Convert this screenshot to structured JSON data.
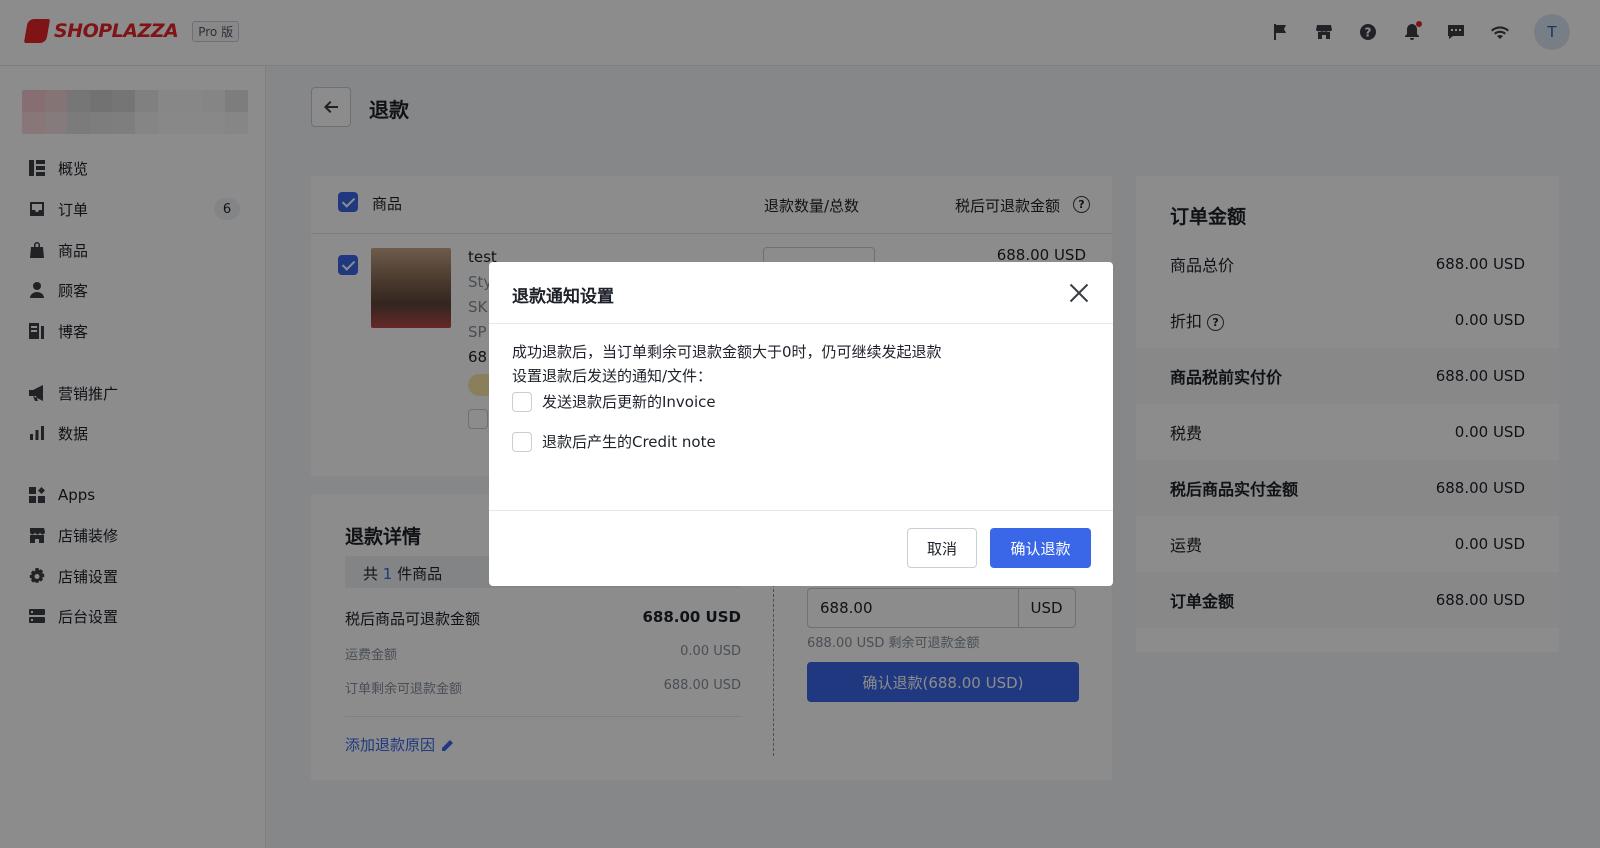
{
  "header": {
    "brand": "SHOPLAZZA",
    "plan_badge": "Pro 版",
    "icons": [
      "flag-icon",
      "store-icon",
      "help-icon",
      "bell-icon",
      "chat-icon",
      "wifi-icon"
    ],
    "avatar_initial": "T"
  },
  "sidebar": {
    "items": [
      {
        "label": "概览",
        "icon": "overview-icon"
      },
      {
        "label": "订单",
        "icon": "orders-icon",
        "badge": "6"
      },
      {
        "label": "商品",
        "icon": "products-icon"
      },
      {
        "label": "顾客",
        "icon": "customers-icon"
      },
      {
        "label": "博客",
        "icon": "blog-icon"
      },
      {
        "label": "营销推广",
        "icon": "megaphone-icon"
      },
      {
        "label": "数据",
        "icon": "analytics-icon"
      },
      {
        "label": "Apps",
        "icon": "apps-icon"
      },
      {
        "label": "店铺装修",
        "icon": "storefront-icon"
      },
      {
        "label": "店铺设置",
        "icon": "settings-icon"
      },
      {
        "label": "后台设置",
        "icon": "server-icon"
      }
    ]
  },
  "page": {
    "title": "退款"
  },
  "products": {
    "header_product": "商品",
    "header_qty": "退款数量/总数",
    "header_amount": "税后可退款金额",
    "item": {
      "name": "test",
      "line2": "Sty",
      "line3": "SK",
      "line4": "SP",
      "line5": "68",
      "amount": "688.00 USD"
    }
  },
  "details": {
    "title": "退款详情",
    "count_prefix": "共",
    "count": "1",
    "count_suffix": "件商品",
    "rows": [
      {
        "label": "税后商品可退款金额",
        "value": "688.00 USD"
      },
      {
        "label": "运费金额",
        "value": "0.00 USD"
      },
      {
        "label": "订单剩余可退款金额",
        "value": "688.00 USD"
      }
    ],
    "add_reason": "添加退款原因",
    "refund_amount": "688.00",
    "currency": "USD",
    "remaining_note": "688.00 USD 剩余可退款金额",
    "confirm_button": "确认退款(688.00 USD)"
  },
  "summary": {
    "title": "订单金额",
    "rows": [
      {
        "label": "商品总价",
        "value": "688.00 USD"
      },
      {
        "label": "折扣",
        "value": "0.00 USD"
      },
      {
        "label": "商品税前实付价",
        "value": "688.00 USD"
      },
      {
        "label": "税费",
        "value": "0.00 USD"
      },
      {
        "label": "税后商品实付金额",
        "value": "688.00 USD"
      },
      {
        "label": "运费",
        "value": "0.00 USD"
      },
      {
        "label": "订单金额",
        "value": "688.00 USD"
      }
    ]
  },
  "modal": {
    "title": "退款通知设置",
    "line1": "成功退款后，当订单剩余可退款金额大于0时，仍可继续发起退款",
    "line2": "设置退款后发送的通知/文件：",
    "option1": "发送退款后更新的Invoice",
    "option2": "退款后产生的Credit note",
    "cancel": "取消",
    "confirm": "确认退款"
  },
  "colors": {
    "accent": "#3a67e8",
    "brand": "#e8262b"
  }
}
